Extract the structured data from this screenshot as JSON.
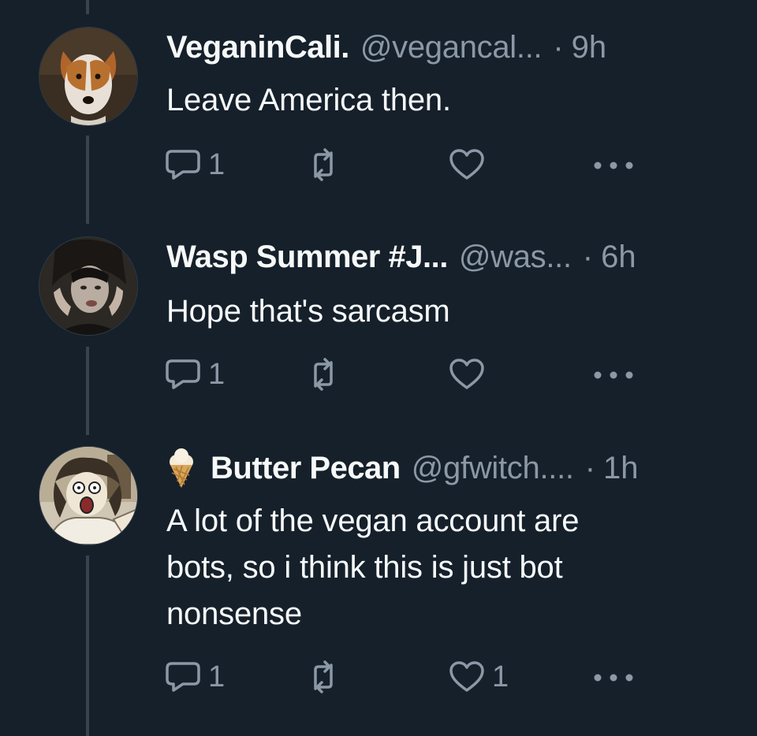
{
  "colors": {
    "background": "#15202b",
    "text_primary": "#f7f9f9",
    "text_secondary": "#8b98a5",
    "thread_line": "#38444d"
  },
  "tweets": [
    {
      "avatar_icon": "dog-avatar",
      "display_name": "VeganinCali.",
      "handle": "@vegancal...",
      "dot": "·",
      "time": "9h",
      "text": "Leave America then.",
      "reply_count": "1",
      "retweet_count": "",
      "like_count": ""
    },
    {
      "avatar_icon": "person-photo-avatar",
      "display_name": "Wasp Summer #J...",
      "handle": "@was...",
      "dot": "·",
      "time": "6h",
      "text": "Hope that's sarcasm",
      "reply_count": "1",
      "retweet_count": "",
      "like_count": ""
    },
    {
      "avatar_icon": "cartoon-avatar",
      "name_emoji": "ice-cream-icon",
      "display_name": "Butter Pecan",
      "handle": "@gfwitch....",
      "dot": "·",
      "time": "1h",
      "text_lines": [
        "A lot of the vegan account are",
        "bots, so i think this is just bot",
        "nonsense"
      ],
      "reply_count": "1",
      "retweet_count": "",
      "like_count": "1"
    }
  ]
}
